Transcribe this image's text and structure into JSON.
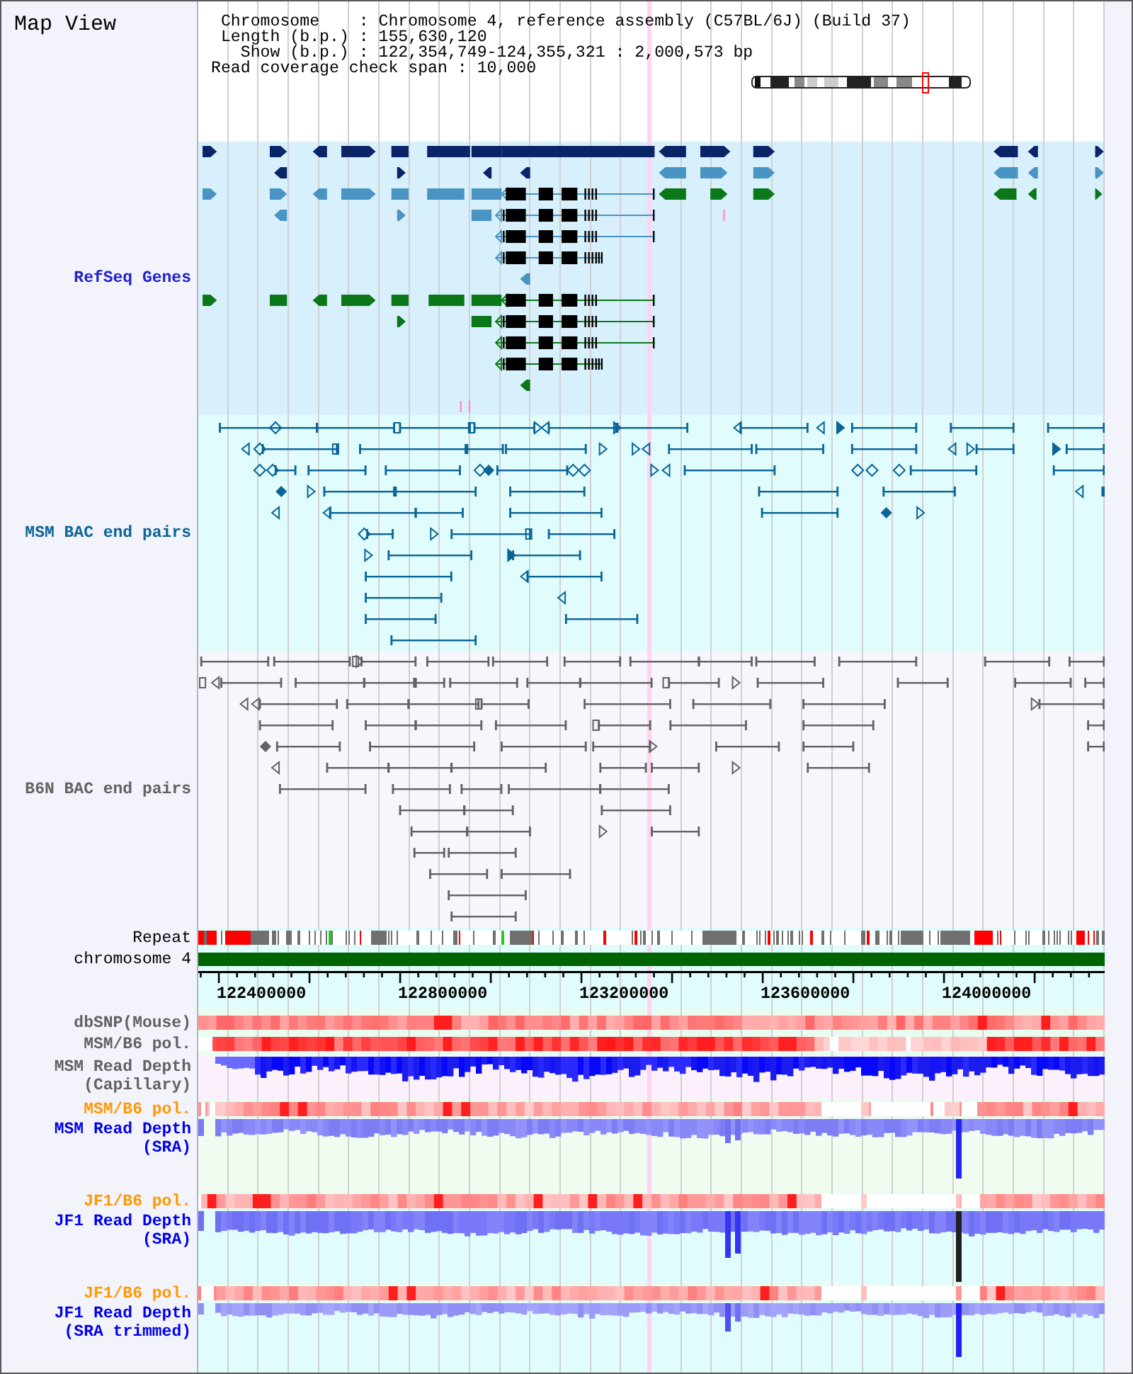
{
  "header": {
    "title": "Map View",
    "info_lines": [
      "Chromosome    : Chromosome 4, reference assembly (C57BL/6J) (Build 37)",
      "Length (b.p.) : 155,630,120",
      "Show (b.p.) : 122,354,749-124,355,321 : 2,000,573 bp",
      "Read coverage check span : 10,000"
    ]
  },
  "tracks": [
    {
      "kind": "genes",
      "label": "RefSeq Genes",
      "color": "#2222cc"
    },
    {
      "kind": "pairs",
      "label": "MSM BAC end pairs",
      "color": "#0a6496"
    },
    {
      "kind": "pairs",
      "label": "B6N BAC end pairs",
      "color": "#626262"
    },
    {
      "kind": "repeat",
      "label": "Repeat"
    },
    {
      "kind": "chromosome",
      "label": "chromosome 4"
    },
    {
      "kind": "ruler",
      "labels": [
        "122400000",
        "122800000",
        "123200000",
        "123600000",
        "124000000"
      ]
    },
    {
      "kind": "heat",
      "label": "dbSNP(Mouse)",
      "color": "#626262"
    },
    {
      "kind": "heat",
      "label": "MSM/B6 pol.",
      "color": "#626262"
    },
    {
      "kind": "depth",
      "label": "MSM Read Depth (Capillary)",
      "color": "#626262"
    },
    {
      "kind": "heat",
      "label": "MSM/B6 pol.",
      "color": "#ff9900"
    },
    {
      "kind": "depth",
      "label": "MSM Read Depth (SRA)",
      "color": "#0000ee"
    },
    {
      "kind": "heat",
      "label": "JF1/B6 pol.",
      "color": "#ff9900"
    },
    {
      "kind": "depth",
      "label": "JF1 Read Depth (SRA)",
      "color": "#0000ee"
    },
    {
      "kind": "heat",
      "label": "JF1/B6 pol.",
      "color": "#ff9900"
    },
    {
      "kind": "depth",
      "label": "JF1 Read Depth (SRA trimmed)",
      "color": "#0000ee"
    }
  ]
}
